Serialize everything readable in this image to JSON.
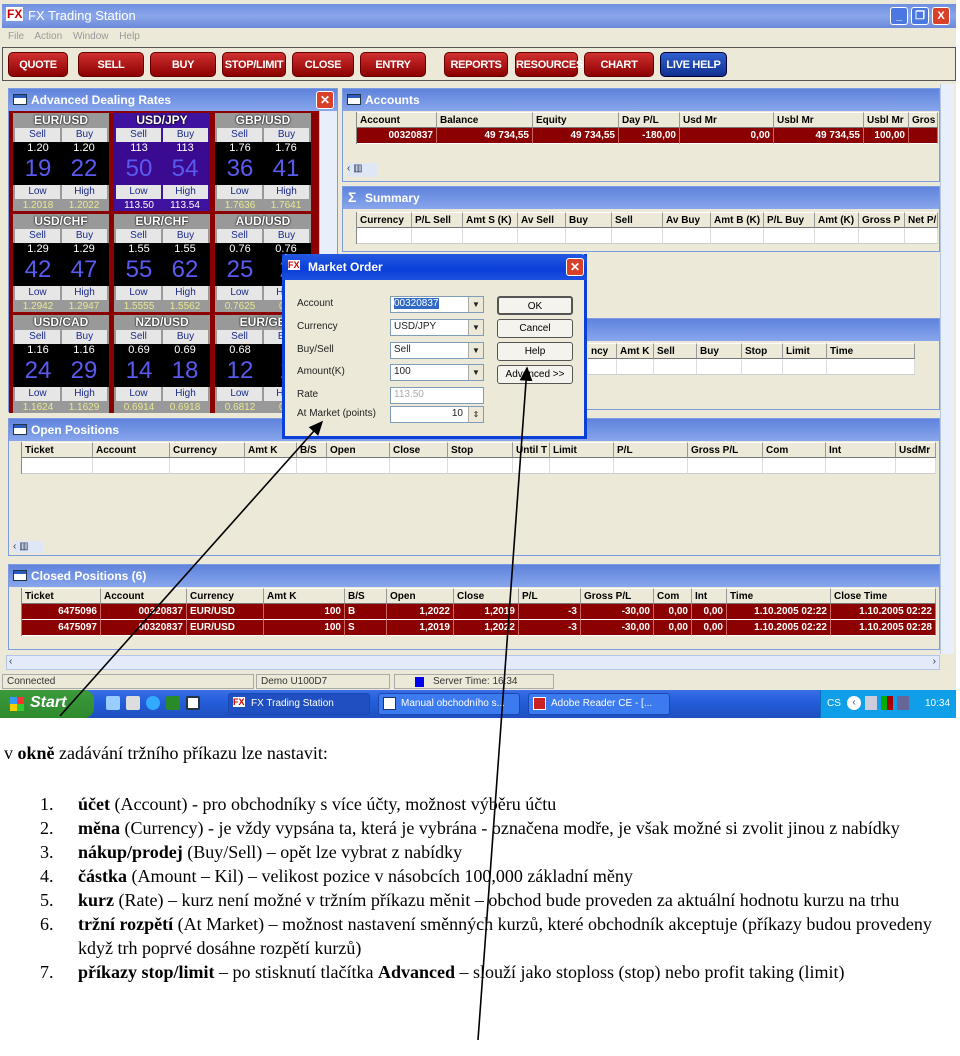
{
  "window": {
    "title": "FX Trading Station",
    "menu": [
      "File",
      "Action",
      "Window",
      "Help"
    ]
  },
  "toolbar": [
    "QUOTE",
    "SELL",
    "BUY",
    "STOP/LIMIT",
    "CLOSE",
    "ENTRY",
    "REPORTS",
    "RESOURCES",
    "CHART",
    "LIVE HELP"
  ],
  "rates": {
    "title": "Advanced Dealing Rates",
    "labels": {
      "sell": "Sell",
      "buy": "Buy",
      "low": "Low",
      "high": "High"
    },
    "tiles": [
      {
        "pair": "EUR/USD",
        "sell_pre": "1.20",
        "sell_big": "19",
        "buy_pre": "1.20",
        "buy_big": "22",
        "low": "1.2018",
        "high": "1.2022",
        "selected": false
      },
      {
        "pair": "USD/JPY",
        "sell_pre": "113",
        "sell_big": "50",
        "buy_pre": "113",
        "buy_big": "54",
        "low": "113.50",
        "high": "113.54",
        "selected": true
      },
      {
        "pair": "GBP/USD",
        "sell_pre": "1.76",
        "sell_big": "36",
        "buy_pre": "1.76",
        "buy_big": "41",
        "low": "1.7636",
        "high": "1.7641",
        "selected": false
      },
      {
        "pair": "USD/CHF",
        "sell_pre": "1.29",
        "sell_big": "42",
        "buy_pre": "1.29",
        "buy_big": "47",
        "low": "1.2942",
        "high": "1.2947",
        "selected": false
      },
      {
        "pair": "EUR/CHF",
        "sell_pre": "1.55",
        "sell_big": "55",
        "buy_pre": "1.55",
        "buy_big": "62",
        "low": "1.5555",
        "high": "1.5562",
        "selected": false
      },
      {
        "pair": "AUD/USD",
        "sell_pre": "0.76",
        "sell_big": "25",
        "buy_pre": "0.76",
        "buy_big": "2",
        "low": "0.7625",
        "high": "0.7",
        "selected": false
      },
      {
        "pair": "USD/CAD",
        "sell_pre": "1.16",
        "sell_big": "24",
        "buy_pre": "1.16",
        "buy_big": "29",
        "low": "1.1624",
        "high": "1.1629",
        "selected": false
      },
      {
        "pair": "NZD/USD",
        "sell_pre": "0.69",
        "sell_big": "14",
        "buy_pre": "0.69",
        "buy_big": "18",
        "low": "0.6914",
        "high": "0.6918",
        "selected": false
      },
      {
        "pair": "EUR/GB",
        "sell_pre": "0.68",
        "sell_big": "12",
        "buy_pre": "0",
        "buy_big": "1",
        "low": "0.6812",
        "high": "0.6",
        "selected": false
      }
    ]
  },
  "accounts": {
    "title": "Accounts",
    "columns": [
      "Account",
      "Balance",
      "Equity",
      "Day P/L",
      "Usd Mr",
      "Usbl Mr",
      "Usbl Mr",
      "Gros"
    ],
    "rows": [
      [
        "00320837",
        "49 734,55",
        "49 734,55",
        "-180,00",
        "0,00",
        "49 734,55",
        "100,00",
        ""
      ]
    ]
  },
  "summary": {
    "title": "Summary",
    "columns": [
      "Currency",
      "P/L Sell",
      "Amt S (K)",
      "Av Sell",
      "Buy",
      "Sell",
      "Av Buy",
      "Amt B (K)",
      "P/L Buy",
      "Amt (K)",
      "Gross P",
      "Net P/"
    ]
  },
  "orders": {
    "columns": [
      "ncy",
      "Amt K",
      "Sell",
      "Buy",
      "Stop",
      "Limit",
      "Time"
    ]
  },
  "open_positions": {
    "title": "Open Positions",
    "columns": [
      "Ticket",
      "Account",
      "Currency",
      "Amt K",
      "B/S",
      "Open",
      "Close",
      "Stop",
      "Until T",
      "Limit",
      "P/L",
      "Gross P/L",
      "Com",
      "Int",
      "UsdMr"
    ]
  },
  "closed_positions": {
    "title": "Closed Positions (6)",
    "columns": [
      "Ticket",
      "Account",
      "Currency",
      "Amt K",
      "B/S",
      "Open",
      "Close",
      "P/L",
      "Gross P/L",
      "Com",
      "Int",
      "Time",
      "Close Time"
    ],
    "rows": [
      [
        "6475096",
        "00320837",
        "EUR/USD",
        "100",
        "B",
        "1,2022",
        "1,2019",
        "-3",
        "-30,00",
        "0,00",
        "0,00",
        "1.10.2005 02:22",
        "1.10.2005 02:22"
      ],
      [
        "6475097",
        "00320837",
        "EUR/USD",
        "100",
        "S",
        "1,2019",
        "1,2022",
        "-3",
        "-30,00",
        "0,00",
        "0,00",
        "1.10.2005 02:22",
        "1.10.2005 02:28"
      ]
    ]
  },
  "status": {
    "connection": "Connected",
    "account": "Demo U100D7",
    "server_time": "Server Time: 16:34"
  },
  "taskbar": {
    "start": "Start",
    "tasks": [
      "FX Trading Station",
      "Manual obchodního s...",
      "Adobe Reader CE - [..."
    ],
    "lang": "CS",
    "clock": "10:34"
  },
  "dialog": {
    "title": "Market Order",
    "fields": [
      {
        "label": "Account",
        "value": "00320837"
      },
      {
        "label": "Currency",
        "value": "USD/JPY"
      },
      {
        "label": "Buy/Sell",
        "value": "Sell"
      },
      {
        "label": "Amount(K)",
        "value": "100"
      },
      {
        "label": "Rate",
        "value": "113.50"
      },
      {
        "label": "At Market (points)",
        "value": "10"
      }
    ],
    "buttons": [
      "OK",
      "Cancel",
      "Help",
      "Advanced >>"
    ]
  },
  "document": {
    "intro_bold": "okně",
    "intro_pre": "v ",
    "intro_post": " zadávání tržního příkazu lze nastavit:",
    "items": [
      {
        "num": "1.",
        "bold": "účet",
        "text": " (Account) - pro obchodníky s více účty, možnost výběru účtu"
      },
      {
        "num": "2.",
        "bold": "měna",
        "text": " (Currency) - je vždy vypsána ta, která je vybrána - označena modře, je však možné si zvolit jinou z nabídky"
      },
      {
        "num": "3.",
        "bold": "nákup/prodej",
        "text": " (Buy/Sell) – opět lze vybrat z nabídky"
      },
      {
        "num": "4.",
        "bold": "částka",
        "text": " (Amount – Kil) – velikost pozice v násobcích 100,000 základní měny"
      },
      {
        "num": "5.",
        "bold": "kurz",
        "text": " (Rate) – kurz není možné v tržním příkazu měnit – obchod bude proveden za aktuální hodnotu kurzu na trhu"
      },
      {
        "num": "6.",
        "bold": "tržní rozpětí",
        "text": " (At Market) – možnost nastavení směnných kurzů, které obchodník akceptuje (příkazy budou provedeny když trh poprvé dosáhne rozpětí kurzů)"
      },
      {
        "num": "7.",
        "bold": "příkazy stop/limit",
        "text": " – po stisknutí tlačítka ",
        "bold2": "Advanced",
        "text2": " – slouží jako stoploss (stop) nebo profit taking (limit)"
      }
    ]
  },
  "colors": {
    "row_red": "#8b0000",
    "selected_tile": "#4012a0",
    "title_blue": "#0a3fd8"
  }
}
